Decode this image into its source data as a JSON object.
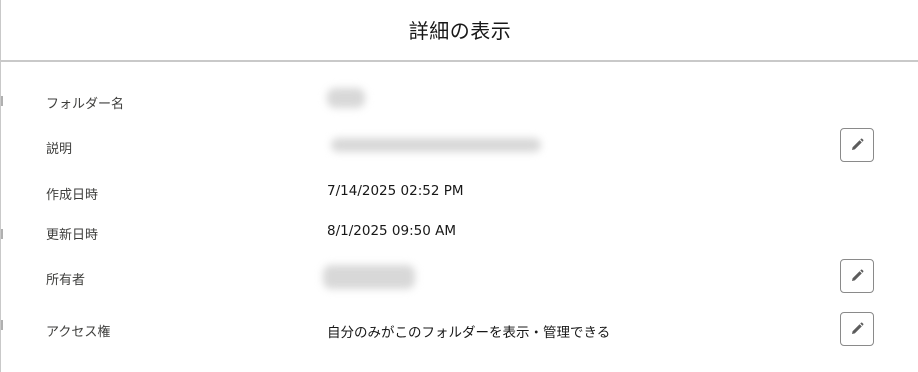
{
  "dialog": {
    "title": "詳細の表示"
  },
  "details": {
    "folder_name": {
      "label": "フォルダー名",
      "value": ""
    },
    "description": {
      "label": "説明",
      "value": ""
    },
    "created_date": {
      "label": "作成日時",
      "value": "7/14/2025 02:52 PM"
    },
    "modified_date": {
      "label": "更新日時",
      "value": "8/1/2025 09:50 AM"
    },
    "owner": {
      "label": "所有者",
      "value": ""
    },
    "access": {
      "label": "アクセス権",
      "value": "自分のみがこのフォルダーを表示・管理できる"
    }
  },
  "icons": {
    "edit": "pencil-icon"
  },
  "colors": {
    "border": "#c9c9c9",
    "button_border": "#8a8a8a",
    "label_text": "#3e3e3c",
    "value_text": "#181818"
  }
}
